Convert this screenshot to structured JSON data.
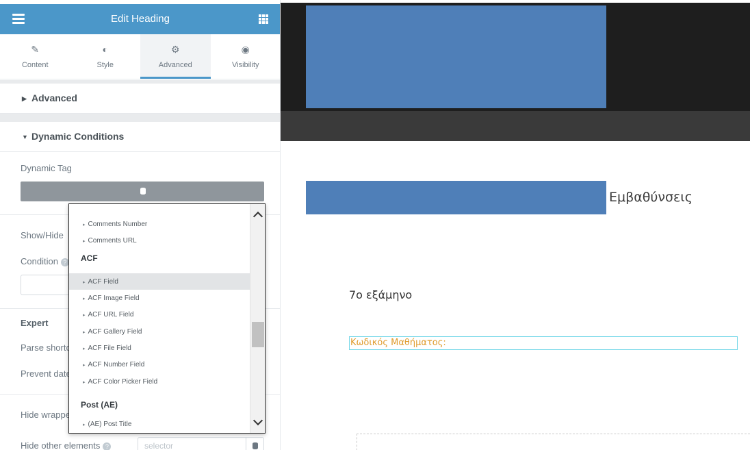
{
  "panel": {
    "title": "Edit Heading",
    "tabs": [
      {
        "label": "Content",
        "icon": "pencil-icon"
      },
      {
        "label": "Style",
        "icon": "contrast-icon"
      },
      {
        "label": "Advanced",
        "icon": "gear-icon",
        "active": true
      },
      {
        "label": "Visibility",
        "icon": "eye-icon"
      }
    ],
    "sections": {
      "advanced": "Advanced",
      "dynamic_conditions": "Dynamic Conditions"
    },
    "controls": {
      "dynamic_tag": "Dynamic Tag",
      "show_hide": "Show/Hide",
      "condition": "Condition",
      "expert": "Expert",
      "parse_shortcodes": "Parse shortc",
      "prevent_date": "Prevent date",
      "hide_wrapper": "Hide wrappe",
      "hide_other_elements": "Hide other elements",
      "selector_placeholder": "selector"
    }
  },
  "dropdown": {
    "items": [
      {
        "type": "item",
        "label": "Comments Number"
      },
      {
        "type": "item",
        "label": "Comments URL"
      },
      {
        "type": "group",
        "label": "ACF"
      },
      {
        "type": "item",
        "label": "ACF Field",
        "highlighted": true
      },
      {
        "type": "item",
        "label": "ACF Image Field"
      },
      {
        "type": "item",
        "label": "ACF URL Field"
      },
      {
        "type": "item",
        "label": "ACF Gallery Field"
      },
      {
        "type": "item",
        "label": "ACF File Field"
      },
      {
        "type": "item",
        "label": "ACF Number Field"
      },
      {
        "type": "item",
        "label": "ACF Color Picker Field"
      },
      {
        "type": "group",
        "label": "Post (AE)"
      },
      {
        "type": "item",
        "label": "(AE) Post Title"
      }
    ]
  },
  "preview": {
    "specializations": "Εμβαθύνσεις",
    "semester": "7ο εξάμηνο",
    "course_code": "Κωδικός Μαθήματος:"
  },
  "colors": {
    "header_blue": "#4b97c9",
    "placeholder_blue": "#4f7fb8",
    "accent_orange": "#e09b2d"
  }
}
